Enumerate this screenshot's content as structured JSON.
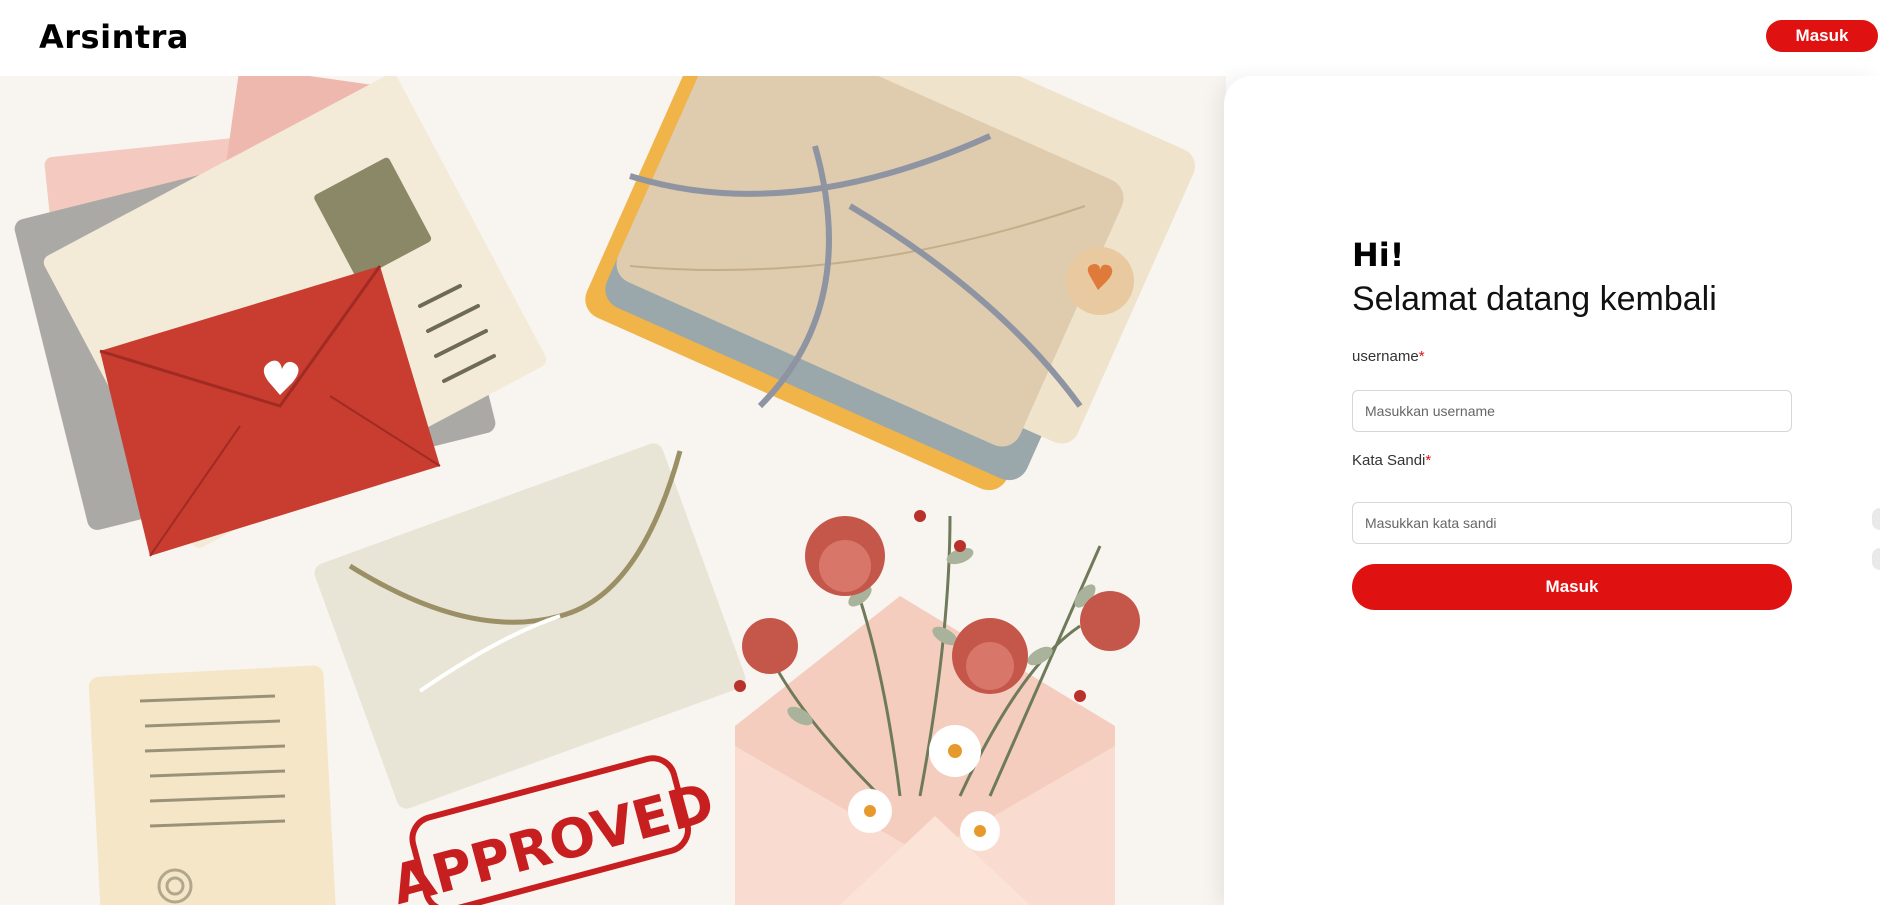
{
  "navbar": {
    "brand": "Arsintra",
    "login_label": "Masuk"
  },
  "illustration": {
    "stamp_text": "APPROVED"
  },
  "login_form": {
    "greeting": "Hi!",
    "subtitle": "Selamat datang kembali",
    "username_label": "username",
    "username_placeholder": "Masukkan username",
    "password_label": "Kata Sandi",
    "password_placeholder": "Masukkan kata sandi",
    "required_marker": "*",
    "submit_label": "Masuk"
  },
  "colors": {
    "accent": "#e01111",
    "illustration_bg": "#f8f4f0"
  }
}
